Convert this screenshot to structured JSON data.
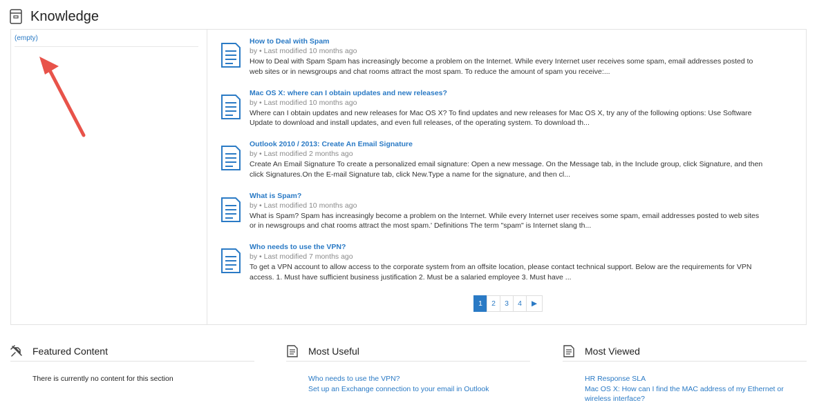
{
  "header": {
    "title": "Knowledge",
    "icon": "knowledge-base-icon"
  },
  "sidebar": {
    "empty_label": "(empty)"
  },
  "articles": [
    {
      "title": "How to Deal with Spam",
      "meta": "by • Last modified 10 months ago",
      "snippet": "How to Deal with Spam Spam has increasingly become a problem on the Internet. While every Internet user receives some spam, email addresses posted to web sites or in newsgroups and chat rooms attract the most spam. To reduce the amount of spam you receive:..."
    },
    {
      "title": "Mac OS X: where can I obtain updates and new releases?",
      "meta": "by • Last modified 10 months ago",
      "snippet": "Where can I obtain updates and new releases for Mac OS X? To find updates and new releases for Mac OS X, try any of the following options: Use Software Update to download and install updates, and even full releases, of the operating system. To download th..."
    },
    {
      "title": "Outlook 2010 / 2013: Create An Email Signature",
      "meta": "by • Last modified 2 months ago",
      "snippet": "Create An Email Signature To create a personalized email signature: Open a new message. On the Message tab, in the Include group, click Signature, and then click Signatures.On the E-mail Signature tab, click New.Type a name for the signature, and then cl..."
    },
    {
      "title": "What is Spam?",
      "meta": "by • Last modified 10 months ago",
      "snippet": "What is Spam? Spam has increasingly become a problem on the Internet. While every Internet user receives some spam, email addresses posted to web sites or in newsgroups and chat rooms attract the most spam.' Definitions The term \"spam\" is Internet slang th..."
    },
    {
      "title": "Who needs to use the VPN?",
      "meta": "by • Last modified 7 months ago",
      "snippet": "To get a VPN account to allow access to the corporate system from an offsite location, please contact technical support. Below are the requirements for VPN access. 1. Must have sufficient business justification 2. Must be a salaried employee 3. Must have ..."
    }
  ],
  "pagination": {
    "pages": [
      "1",
      "2",
      "3",
      "4"
    ],
    "current": "1",
    "next_icon": "▶"
  },
  "featured": {
    "title": "Featured Content",
    "icon": "pin-icon",
    "empty_text": "There is currently no content for this section"
  },
  "most_useful": {
    "title": "Most Useful",
    "icon": "document-icon",
    "links": [
      "Who needs to use the VPN?",
      "Set up an Exchange connection to your email in Outlook"
    ]
  },
  "most_viewed": {
    "title": "Most Viewed",
    "icon": "document-icon",
    "links": [
      "HR Response SLA",
      "Mac OS X: How can I find the MAC address of my Ethernet or wireless interface?"
    ]
  },
  "colors": {
    "link": "#2a7ac5",
    "arrow": "#e8534a",
    "meta": "#8a8a8a",
    "border": "#e3e3e3"
  }
}
